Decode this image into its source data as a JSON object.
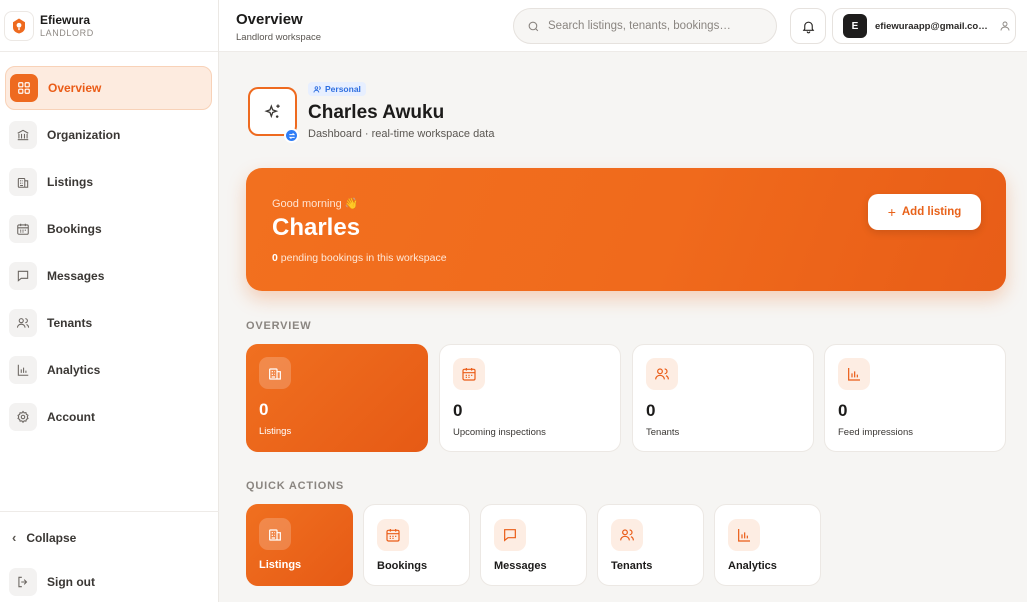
{
  "brand": {
    "name": "Efiewura",
    "role": "LANDLORD"
  },
  "sidebar": {
    "items": [
      {
        "label": "Overview",
        "icon": "grid-icon",
        "active": true
      },
      {
        "label": "Organization",
        "icon": "bank-icon"
      },
      {
        "label": "Listings",
        "icon": "building-icon"
      },
      {
        "label": "Bookings",
        "icon": "calendar-icon"
      },
      {
        "label": "Messages",
        "icon": "message-icon"
      },
      {
        "label": "Tenants",
        "icon": "users-icon"
      },
      {
        "label": "Analytics",
        "icon": "bar-chart-icon"
      },
      {
        "label": "Account",
        "icon": "gear-icon"
      }
    ],
    "collapse_label": "Collapse",
    "signout_label": "Sign out"
  },
  "header": {
    "title": "Overview",
    "subtitle": "Landlord workspace",
    "search_placeholder": "Search listings, tenants, bookings…",
    "avatar_initial": "E",
    "email": "efiewuraapp@gmail.co…"
  },
  "workspace": {
    "badge": "Personal",
    "name": "Charles Awuku",
    "description": "Dashboard · real-time workspace data"
  },
  "hero": {
    "greeting": "Good morning 👋",
    "name": "Charles",
    "pending_count": "0",
    "pending_text": " pending bookings in this workspace",
    "add_listing_label": "Add listing"
  },
  "overview": {
    "section_label": "OVERVIEW",
    "stats": [
      {
        "value": "0",
        "label": "Listings",
        "icon": "building-icon"
      },
      {
        "value": "0",
        "label": "Upcoming inspections",
        "icon": "calendar-icon"
      },
      {
        "value": "0",
        "label": "Tenants",
        "icon": "users-icon"
      },
      {
        "value": "0",
        "label": "Feed impressions",
        "icon": "bar-chart-icon"
      }
    ]
  },
  "quick_actions": {
    "section_label": "QUICK ACTIONS",
    "items": [
      {
        "label": "Listings",
        "icon": "building-icon"
      },
      {
        "label": "Bookings",
        "icon": "calendar-icon"
      },
      {
        "label": "Messages",
        "icon": "message-icon"
      },
      {
        "label": "Tenants",
        "icon": "users-icon"
      },
      {
        "label": "Analytics",
        "icon": "bar-chart-icon"
      }
    ]
  },
  "colors": {
    "accent": "#EE6A1F",
    "badge_blue": "#2F7DF6"
  }
}
